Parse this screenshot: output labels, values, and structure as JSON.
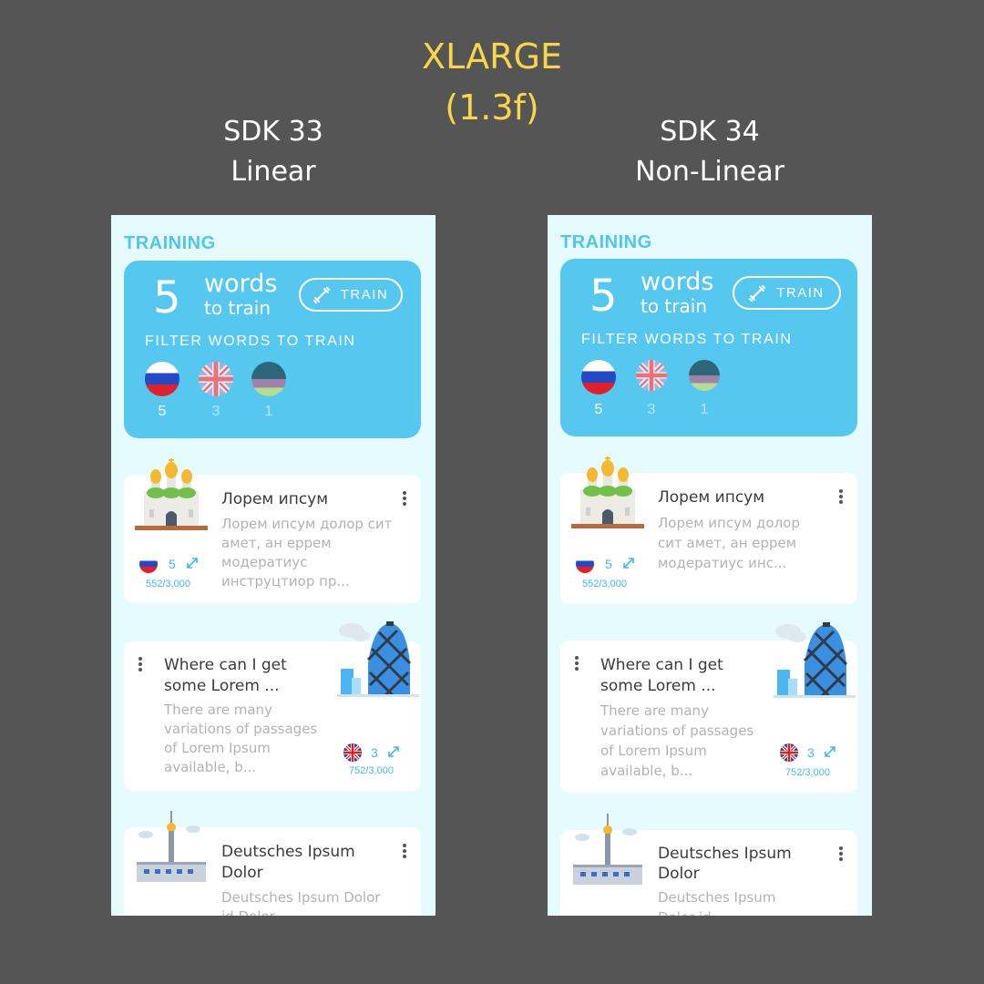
{
  "header": {
    "title": "XLARGE",
    "subtitle": "(1.3f)"
  },
  "columns": [
    {
      "line1": "SDK 33",
      "line2": "Linear"
    },
    {
      "line1": "SDK 34",
      "line2": "Non-Linear"
    }
  ],
  "screen": {
    "section_label": "TRAINING",
    "train_card": {
      "count": "5",
      "words": "words",
      "sub": "to train",
      "button_label": "TRAIN",
      "filter_label": "FILTER WORDS TO TRAIN",
      "flags": [
        {
          "icon": "russia-flag-icon",
          "count": "5"
        },
        {
          "icon": "uk-flag-icon",
          "count": "3"
        },
        {
          "icon": "germany-flag-icon",
          "count": "1"
        }
      ]
    },
    "cards": [
      {
        "title": "Лорем ипсум",
        "text_linear": "Лорем ипсум долор сит амет, ан еррем модератиус инструцтиор пр...",
        "text_nonlinear": "Лорем ипсум долор сит амет, ан еррем модератиус инс...",
        "count": "5",
        "progress": "552/3,000",
        "illustration": "cathedral-icon"
      },
      {
        "title": "Where can I get some Lorem ...",
        "text": "There are many variations of passages of Lorem Ipsum available, b...",
        "count": "3",
        "progress": "752/3,000",
        "illustration": "gherkin-tower-icon"
      },
      {
        "title": "Deutsches Ipsum Dolor",
        "text_linear": "Deutsches Ipsum Dolor id Dolor",
        "text_nonlinear": "Deutsches Ipsum Dolor id",
        "illustration": "tv-tower-icon"
      }
    ]
  },
  "colors": {
    "background": "#555555",
    "title": "#f7d64a",
    "accent": "#56c8f0",
    "screen_bg": "#e6fbfd"
  }
}
